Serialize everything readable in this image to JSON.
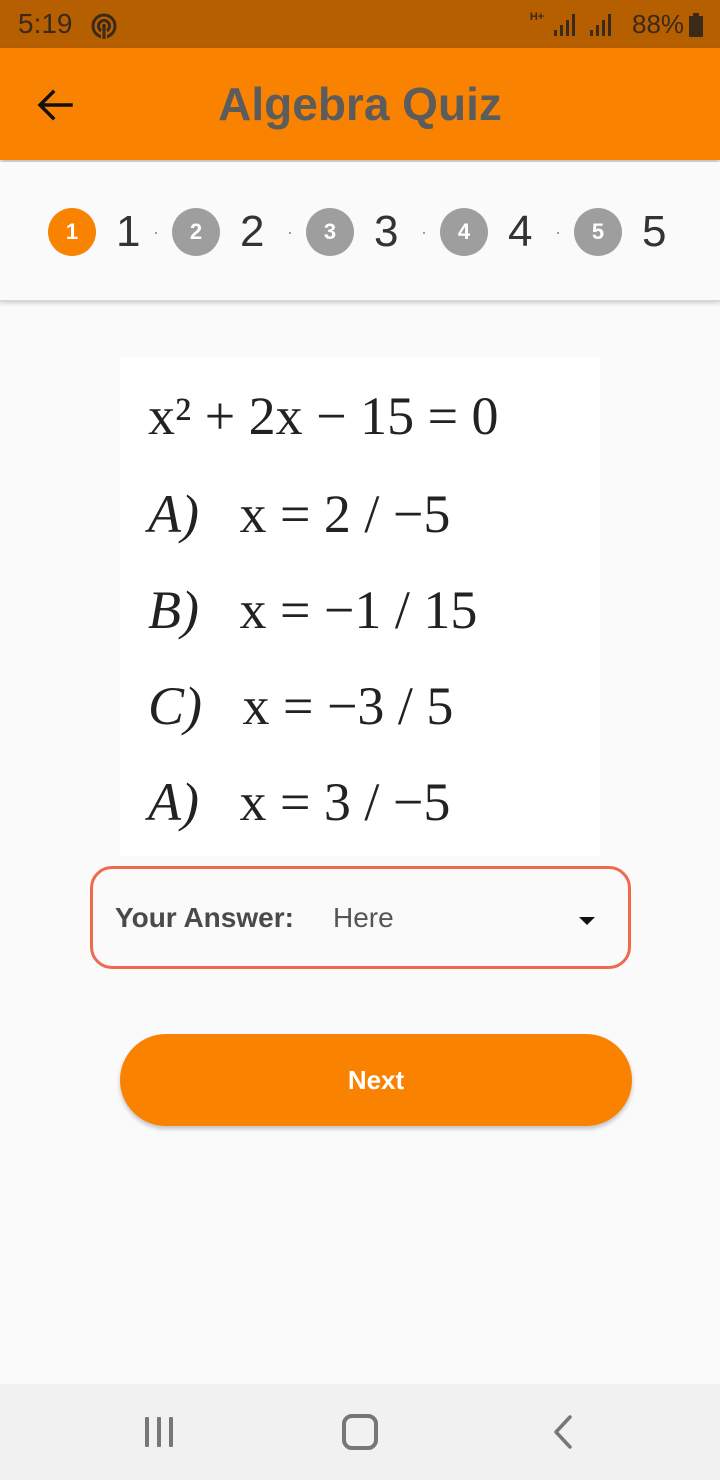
{
  "status_bar": {
    "time": "5:19",
    "network_type": "H+",
    "battery": "88%",
    "icons": [
      "hotspot-icon",
      "signal-icon",
      "signal-icon",
      "battery-icon"
    ]
  },
  "app_bar": {
    "title": "Algebra Quiz",
    "back_icon": "arrow-left-icon",
    "background_color": "#f98300",
    "title_color": "#5c5c5c"
  },
  "stepper": {
    "steps": [
      {
        "number": "1",
        "label": "1",
        "active": true
      },
      {
        "number": "2",
        "label": "2",
        "active": false
      },
      {
        "number": "3",
        "label": "3",
        "active": false
      },
      {
        "number": "4",
        "label": "4",
        "active": false
      },
      {
        "number": "5",
        "label": "5",
        "active": false
      }
    ],
    "active_color": "#f98300",
    "inactive_color": "#9e9e9e"
  },
  "question": {
    "equation": "x² + 2x − 15 = 0",
    "options": [
      {
        "letter": "A)",
        "answer": "x = 2 / −5"
      },
      {
        "letter": "B)",
        "answer": "x = −1 / 15"
      },
      {
        "letter": "C)",
        "answer": "x = −3 / 5"
      },
      {
        "letter": "A)",
        "answer": "x = 3 / −5"
      }
    ]
  },
  "answer_field": {
    "label": "Your Answer:",
    "selected_value": "Here",
    "border_color": "#ee6a4f",
    "dropdown_icon": "caret-down-icon"
  },
  "next_button": {
    "label": "Next",
    "color": "#f98300"
  },
  "nav_bar": {
    "icons": [
      "recent-apps-icon",
      "home-icon",
      "back-icon"
    ]
  }
}
